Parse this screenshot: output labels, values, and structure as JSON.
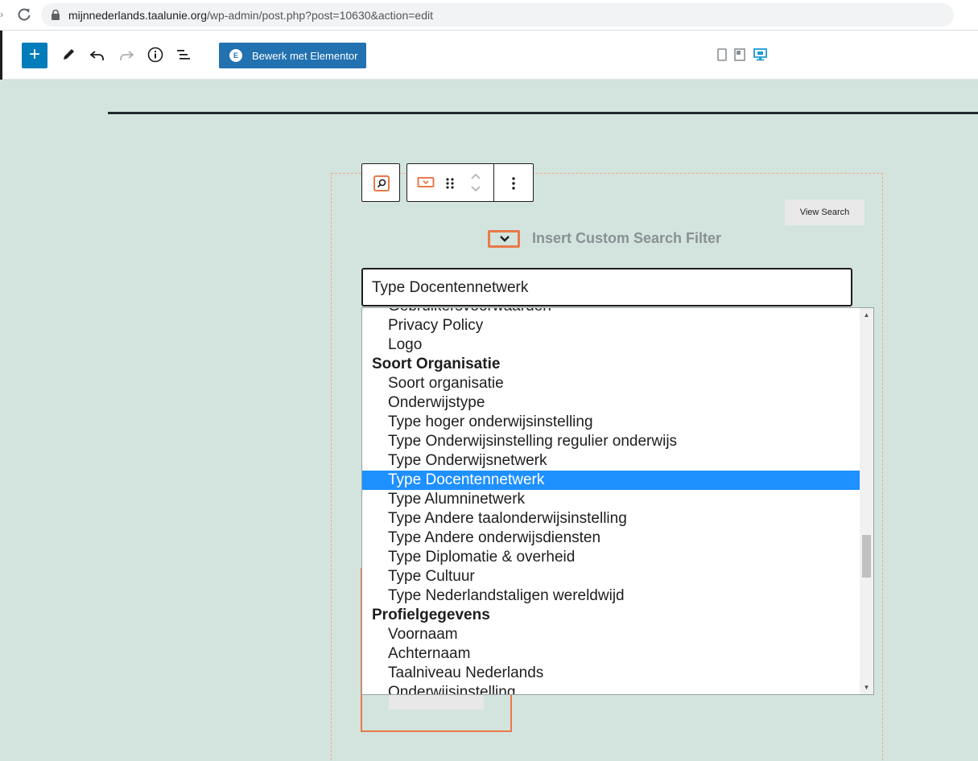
{
  "browser": {
    "url_host": "mijnnederlands.taalunie.org",
    "url_path": "/wp-admin/post.php?post=10630&action=edit"
  },
  "toolbar": {
    "elementor_button_label": "Bewerk met Elementor",
    "icons": [
      "plus-icon",
      "pencil-icon",
      "undo-icon",
      "redo-icon",
      "info-icon",
      "list-view-icon"
    ],
    "preview_icons": [
      "mobile-preview-icon",
      "tablet-preview-icon",
      "desktop-preview-icon"
    ],
    "accent_color": "#007cba",
    "active_preview_color": "#1e9bcc"
  },
  "block": {
    "view_search_label": "View Search",
    "filter_title": "Insert Custom Search Filter",
    "selected_value": "Type Docentennetwerk",
    "border_color": "#e8794a"
  },
  "dropdown": {
    "options": [
      {
        "label": "Gebruikersvoorwaarden",
        "group": false,
        "selected": false
      },
      {
        "label": "Privacy Policy",
        "group": false,
        "selected": false
      },
      {
        "label": "Logo",
        "group": false,
        "selected": false
      },
      {
        "label": "Soort Organisatie",
        "group": true,
        "selected": false
      },
      {
        "label": "Soort organisatie",
        "group": false,
        "selected": false
      },
      {
        "label": "Onderwijstype",
        "group": false,
        "selected": false
      },
      {
        "label": "Type hoger onderwijsinstelling",
        "group": false,
        "selected": false
      },
      {
        "label": "Type Onderwijsinstelling regulier onderwijs",
        "group": false,
        "selected": false
      },
      {
        "label": "Type Onderwijsnetwerk",
        "group": false,
        "selected": false
      },
      {
        "label": "Type Docentennetwerk",
        "group": false,
        "selected": true
      },
      {
        "label": "Type Alumninetwerk",
        "group": false,
        "selected": false
      },
      {
        "label": "Type Andere taalonderwijsinstelling",
        "group": false,
        "selected": false
      },
      {
        "label": "Type Andere onderwijsdiensten",
        "group": false,
        "selected": false
      },
      {
        "label": "Type Diplomatie & overheid",
        "group": false,
        "selected": false
      },
      {
        "label": "Type Cultuur",
        "group": false,
        "selected": false
      },
      {
        "label": "Type Nederlandstaligen wereldwijd",
        "group": false,
        "selected": false
      },
      {
        "label": "Profielgegevens",
        "group": true,
        "selected": false
      },
      {
        "label": "Voornaam",
        "group": false,
        "selected": false
      },
      {
        "label": "Achternaam",
        "group": false,
        "selected": false
      },
      {
        "label": "Taalniveau Nederlands",
        "group": false,
        "selected": false
      },
      {
        "label": "Onderwijsinstelling",
        "group": false,
        "selected": false
      }
    ],
    "highlight_color": "#1e90ff",
    "scroll_position": 0.6
  }
}
